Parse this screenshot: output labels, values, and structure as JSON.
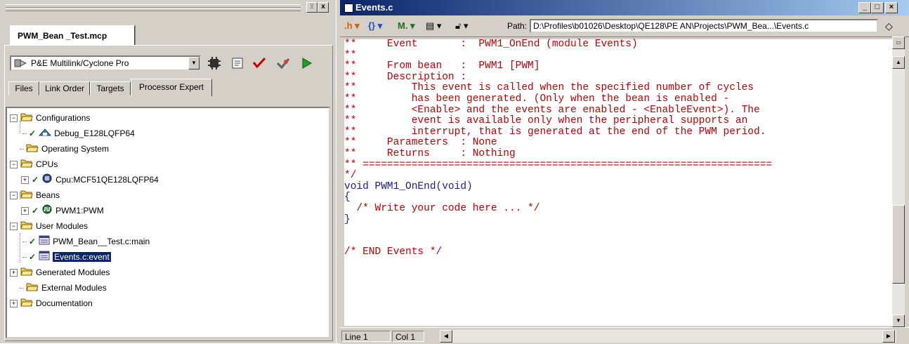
{
  "left_panel": {
    "project_tab": "PWM_Bean _Test.mcp",
    "target_select": "P&E Multilink/Cyclone Pro",
    "subtabs": [
      "Files",
      "Link Order",
      "Targets",
      "Processor Expert"
    ],
    "tree": [
      {
        "label": "Configurations",
        "expander": "−"
      },
      {
        "label": "Debug_E128LQFP64"
      },
      {
        "label": "Operating System"
      },
      {
        "label": "CPUs",
        "expander": "−"
      },
      {
        "label": "Cpu:MCF51QE128LQFP64",
        "expander": "+"
      },
      {
        "label": "Beans",
        "expander": "−"
      },
      {
        "label": "PWM1:PWM",
        "expander": "+"
      },
      {
        "label": "User Modules",
        "expander": "−"
      },
      {
        "label": "PWM_Bean__Test.c:main"
      },
      {
        "label": "Events.c:event"
      },
      {
        "label": "Generated Modules",
        "expander": "+"
      },
      {
        "label": "External Modules"
      },
      {
        "label": "Documentation",
        "expander": "+"
      }
    ],
    "window_buttons": [
      "x"
    ]
  },
  "editor": {
    "title": "Events.c",
    "window_buttons": [
      "_",
      "□",
      "×"
    ],
    "path_label": "Path:",
    "path_value": "D:\\Profiles\\b01026\\Desktop\\QE128\\PE AN\\Projects\\PWM_Bea...\\Events.c",
    "code_lines": [
      {
        "text": "**     Event       :  PWM1_OnEnd (module Events)",
        "color": "red"
      },
      {
        "text": "**",
        "color": "red"
      },
      {
        "text": "**     From bean   :  PWM1 [PWM]",
        "color": "red"
      },
      {
        "text": "**     Description :",
        "color": "red"
      },
      {
        "text": "**         This event is called when the specified number of cycles",
        "color": "red"
      },
      {
        "text": "**         has been generated. (Only when the bean is enabled -",
        "color": "red"
      },
      {
        "text": "**         <Enable> and the events are enabled - <EnableEvent>). The",
        "color": "red"
      },
      {
        "text": "**         event is available only when the peripheral supports an",
        "color": "red"
      },
      {
        "text": "**         interrupt, that is generated at the end of the PWM period.",
        "color": "red"
      },
      {
        "text": "**     Parameters  : None",
        "color": "red"
      },
      {
        "text": "**     Returns     : Nothing",
        "color": "red"
      },
      {
        "text": "** ===================================================================",
        "color": "red"
      },
      {
        "text": "*/",
        "color": "red"
      },
      {
        "text": "void PWM1_OnEnd(void)",
        "color": "blue"
      },
      {
        "text": "{",
        "color": "blue"
      },
      {
        "text": "  /* Write your code here ... */",
        "color": "red"
      },
      {
        "text": "}",
        "color": "blue"
      },
      {
        "text": "",
        "color": "blue"
      },
      {
        "text": "",
        "color": "blue"
      },
      {
        "text": "/* END Events */",
        "color": "red"
      }
    ],
    "status": {
      "line": "Line 1",
      "col": "Col 1"
    }
  }
}
